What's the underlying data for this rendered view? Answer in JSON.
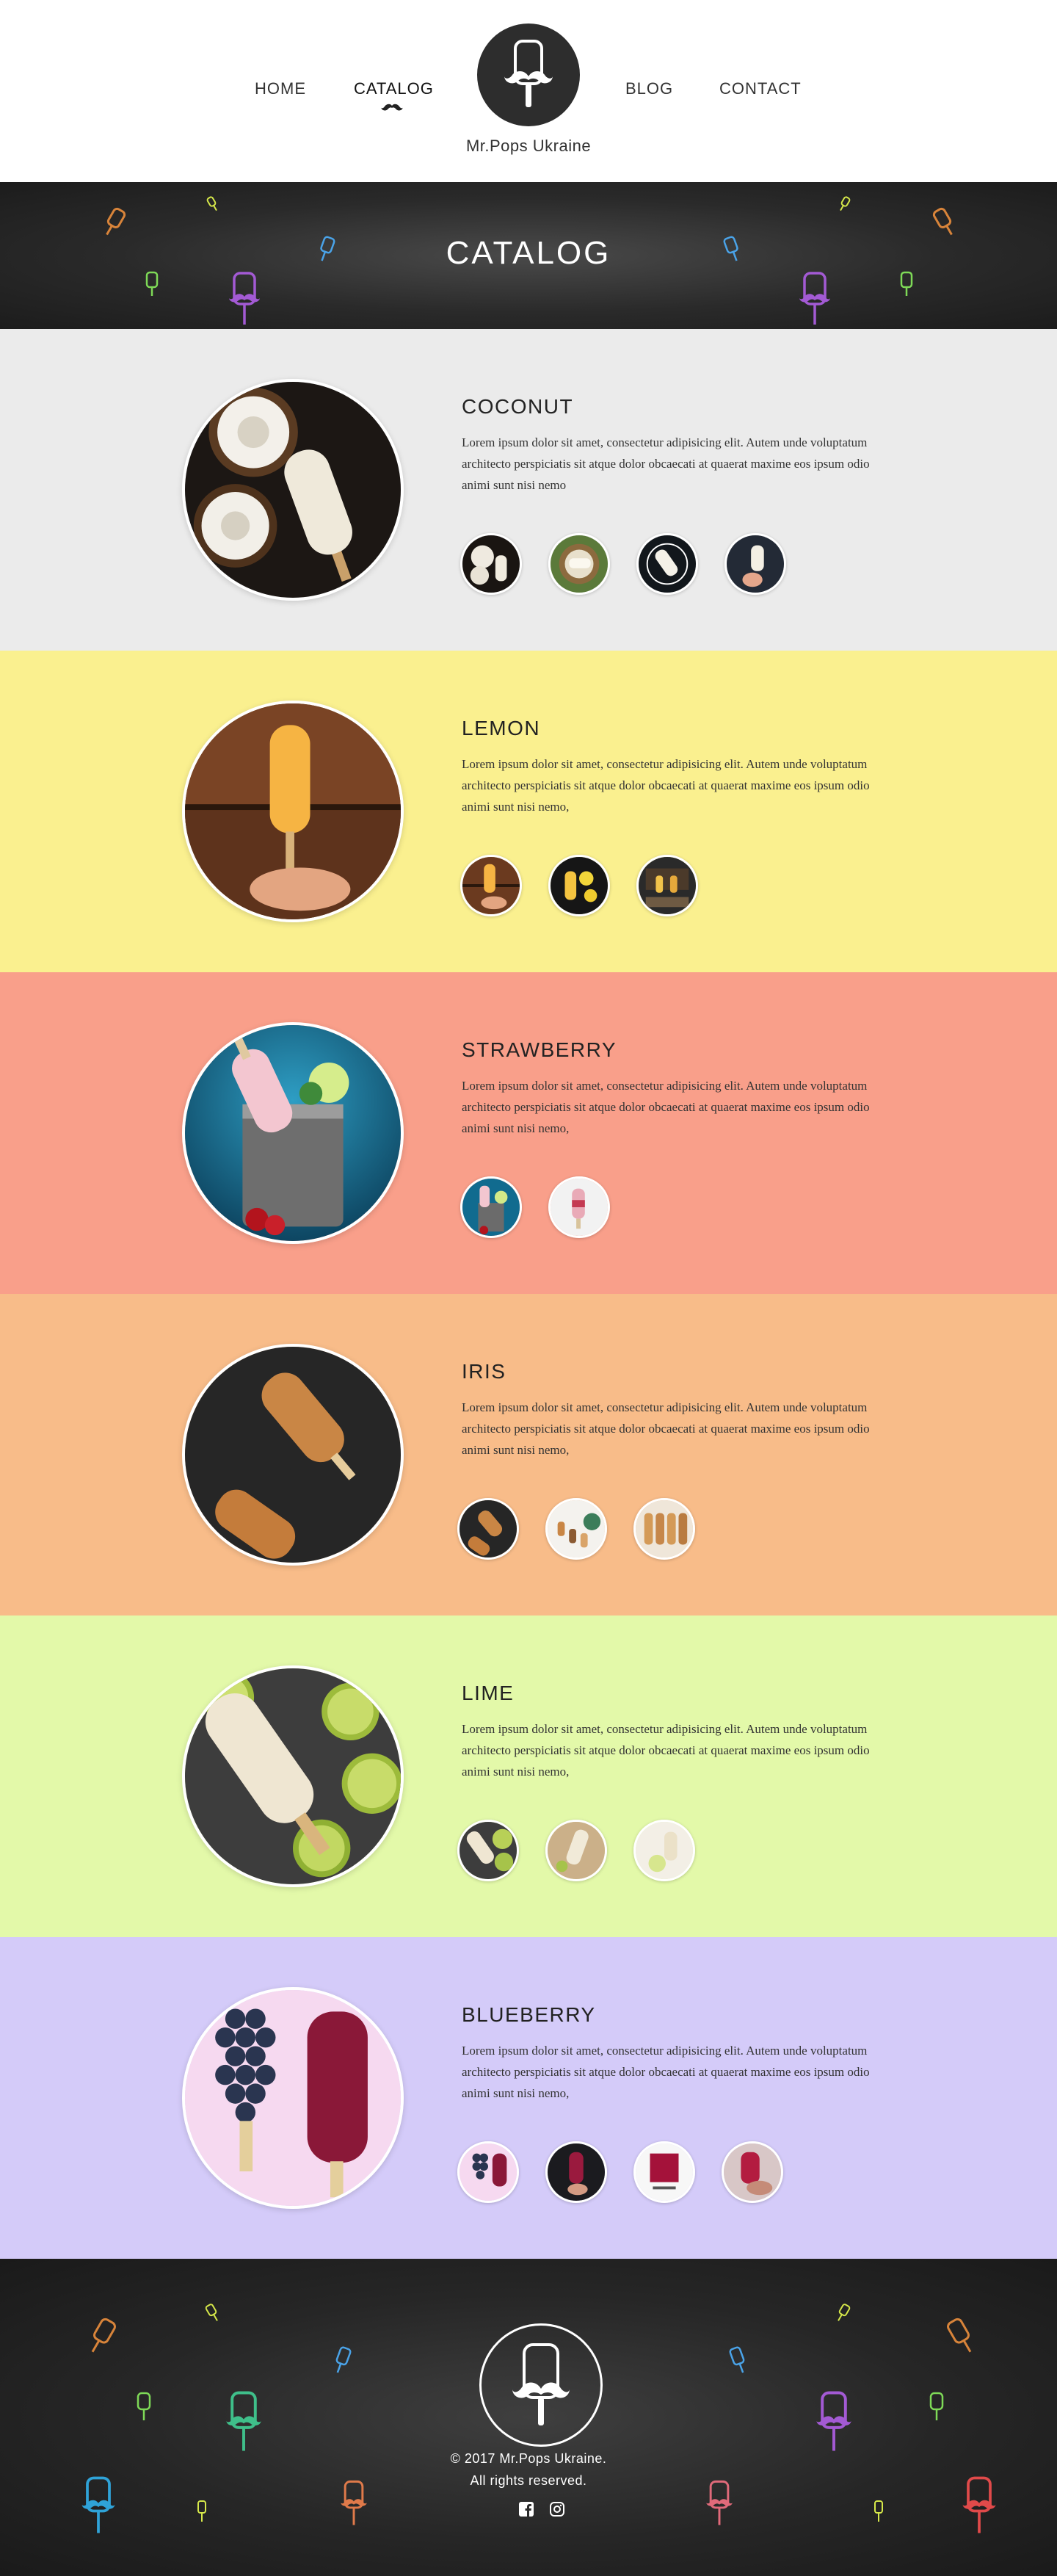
{
  "header": {
    "nav_left": [
      "HOME",
      "CATALOG"
    ],
    "nav_right": [
      "BLOG",
      "CONTACT"
    ],
    "active": "CATALOG",
    "brand": "Mr.Pops Ukraine"
  },
  "banner": {
    "title": "CATALOG"
  },
  "colors": {
    "coconut": "#ebebeb",
    "lemon": "#faf08f",
    "strawberry": "#f99f8a",
    "iris": "#f8bc89",
    "lime": "#e3f9a9",
    "blueberry": "#d4cbf9",
    "dark": "#2a2a2a"
  },
  "products": [
    {
      "title": "COCONUT",
      "desc": "Lorem ipsum dolor sit amet, consectetur adipisicing elit. Autem unde voluptatum architecto perspiciatis sit atque dolor obcaecati at quaerat maxime eos ipsum odio animi sunt nisi nemo"
    },
    {
      "title": "LEMON",
      "desc": "Lorem ipsum dolor sit amet, consectetur adipisicing elit. Autem unde voluptatum architecto perspiciatis sit atque dolor obcaecati at quaerat maxime eos ipsum odio animi sunt nisi nemo,"
    },
    {
      "title": "STRAWBERRY",
      "desc": "Lorem ipsum dolor sit amet, consectetur adipisicing elit. Autem unde voluptatum architecto perspiciatis sit atque dolor obcaecati at quaerat maxime eos ipsum odio animi sunt nisi nemo,"
    },
    {
      "title": "IRIS",
      "desc": "Lorem ipsum dolor sit amet, consectetur adipisicing elit. Autem unde voluptatum architecto perspiciatis sit atque dolor obcaecati at quaerat maxime eos ipsum odio animi sunt nisi nemo,"
    },
    {
      "title": "LIME",
      "desc": "Lorem ipsum dolor sit amet, consectetur adipisicing elit. Autem unde voluptatum architecto perspiciatis sit atque dolor obcaecati at quaerat maxime eos ipsum odio animi sunt nisi nemo,"
    },
    {
      "title": "BLUEBERRY",
      "desc": "Lorem ipsum dolor sit amet, consectetur adipisicing elit. Autem unde voluptatum architecto perspiciatis sit atque dolor obcaecati at quaerat maxime eos ipsum odio animi sunt nisi nemo,"
    }
  ],
  "footer": {
    "copyright": "© 2017 Mr.Pops Ukraine.",
    "rights": "All rights reserved.",
    "social_icons": [
      "facebook-icon",
      "instagram-icon"
    ]
  }
}
